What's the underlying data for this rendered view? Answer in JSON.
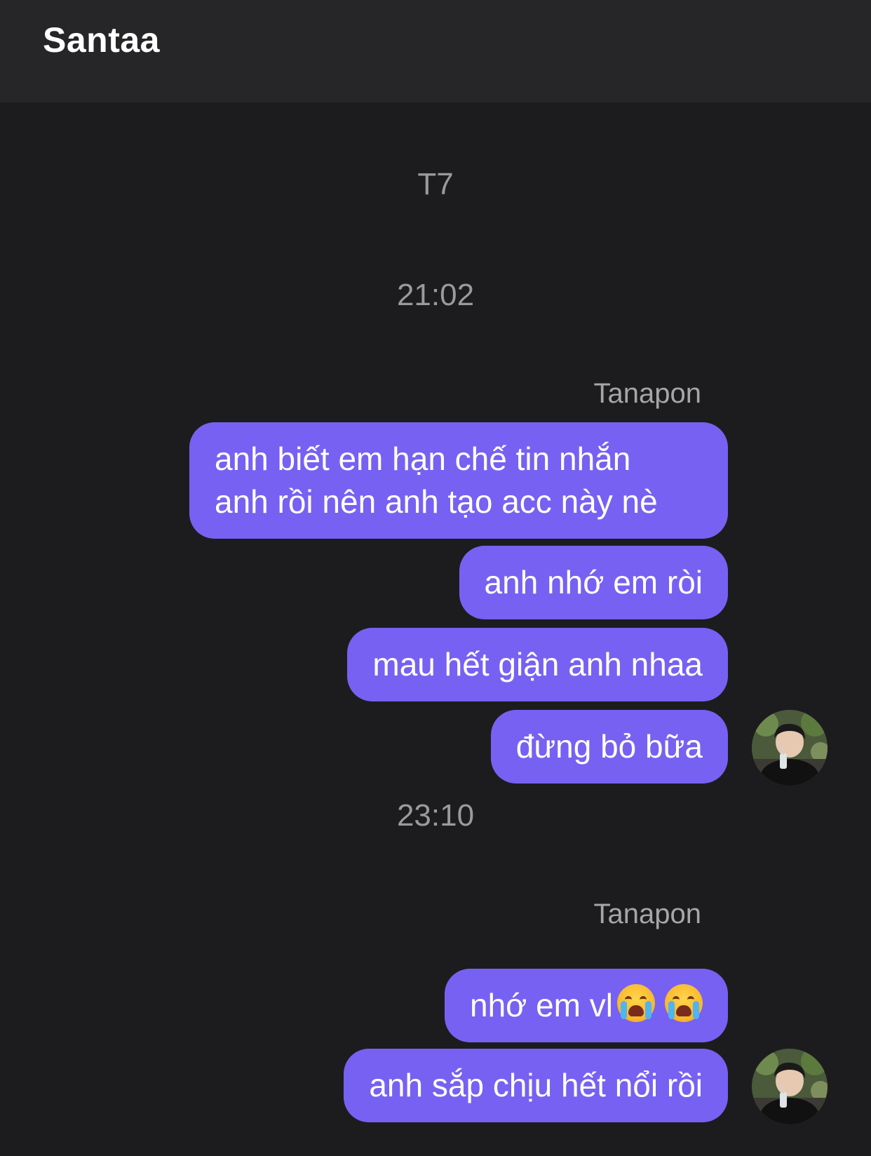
{
  "header": {
    "title": "Santaa"
  },
  "conversation": {
    "day_label": "T7",
    "groups": [
      {
        "time": "21:02",
        "sender": "Tanapon",
        "messages": [
          {
            "lines": [
              "anh biết em hạn chế tin nhắn",
              "anh rồi nên anh tạo acc này nè"
            ]
          },
          {
            "text": "anh nhớ em ròi"
          },
          {
            "text": "mau hết giận anh nhaa"
          },
          {
            "text": "đừng bỏ bữa"
          }
        ]
      },
      {
        "time": "23:10",
        "sender": "Tanapon",
        "messages": [
          {
            "text": "nhớ em vl",
            "emoji": [
              "loudly-crying-face-icon",
              "loudly-crying-face-icon"
            ]
          },
          {
            "text": "anh sắp chịu hết nổi rồi"
          }
        ]
      }
    ]
  },
  "colors": {
    "background": "#1c1c1e",
    "header": "#262628",
    "bubble": "#7761f2",
    "timestamp": "#9a9a9e"
  }
}
